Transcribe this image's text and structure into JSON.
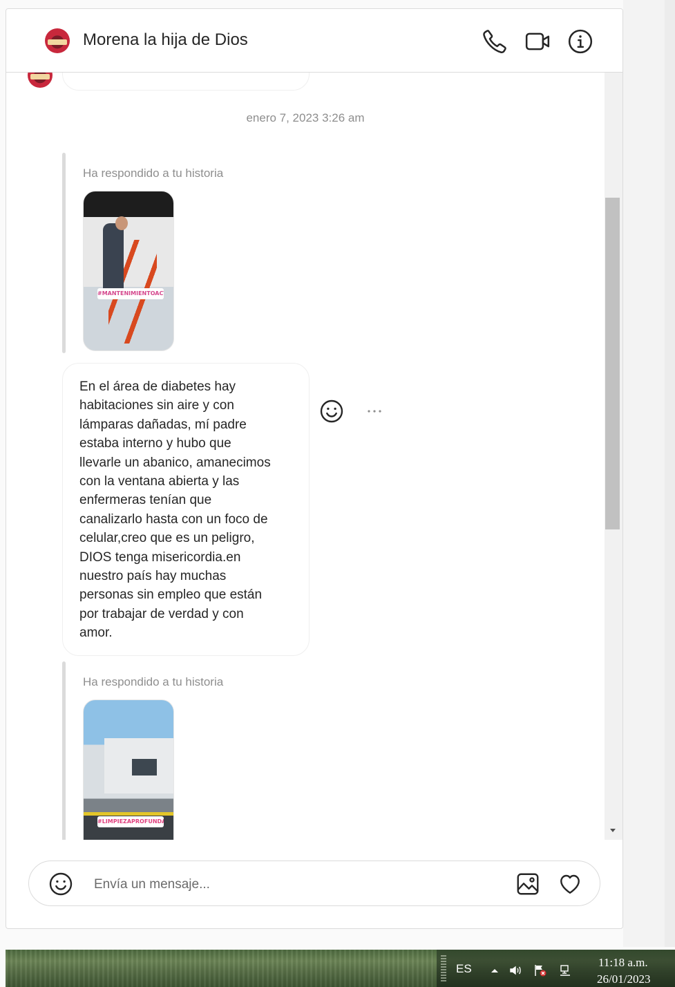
{
  "header": {
    "contact_name": "Morena la hija de Dios"
  },
  "thread": {
    "timestamp": "enero 7, 2023 3:26 am",
    "story_reply_1": {
      "label": "Ha respondido a tu historia",
      "sticker": "#MANTENIMIENTOACTIVO 💪"
    },
    "message": {
      "text": "En el área de diabetes hay\nhabitaciones sin aire y con\nlámparas dañadas, mí padre\nestaba interno y hubo que\nllevarle un abanico, amanecimos\ncon la ventana abierta y las\nenfermeras tenían que\ncanalizarlo hasta con un foco de\ncelular,creo que es un peligro,\nDIOS tenga misericordia.en\nnuestro país hay muchas\npersonas sin empleo que están\npor trabajar de verdad y con\namor."
    },
    "story_reply_2": {
      "label": "Ha respondido a tu historia",
      "sticker": "#LIMPIEZAPROFUNDA"
    }
  },
  "composer": {
    "placeholder": "Envía un mensaje..."
  },
  "taskbar": {
    "language": "ES",
    "time": "11:18 a.m.",
    "date": "26/01/2023"
  },
  "icons": {
    "call": "phone-icon",
    "video": "video-camera-icon",
    "info": "info-icon",
    "react": "emoji-icon",
    "more": "more-horizontal-icon",
    "image": "image-icon",
    "like": "heart-icon"
  },
  "colors": {
    "text": "#262626",
    "muted": "#8e8e8e",
    "border": "#dbdbdb",
    "avatar": "#c8283c"
  }
}
